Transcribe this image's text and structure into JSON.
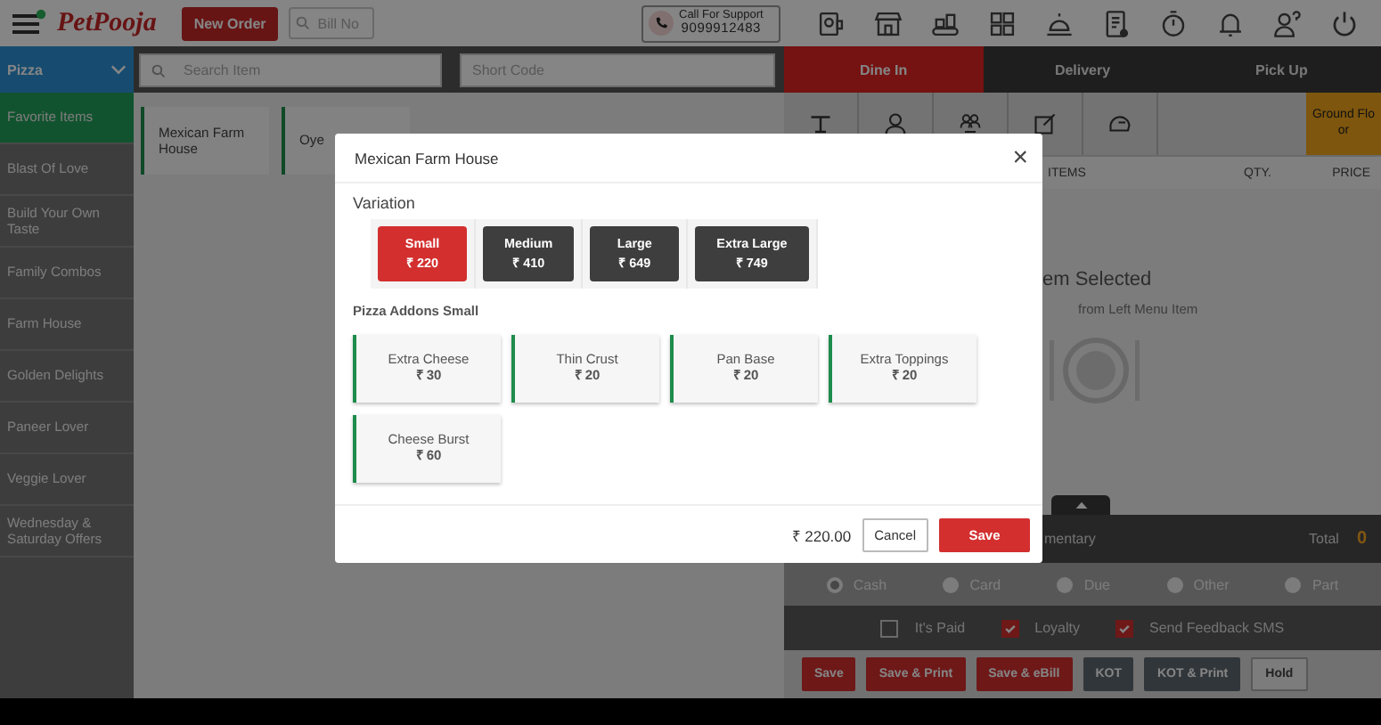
{
  "header": {
    "brand": "PetPooja",
    "new_order": "New Order",
    "bill_placeholder": "Bill No",
    "support_label": "Call For Support",
    "support_phone": "9099912483"
  },
  "category_select": "Pizza",
  "search": {
    "placeholder": "Search Item"
  },
  "short_code": {
    "placeholder": "Short Code"
  },
  "order_tabs": [
    {
      "label": "Dine In",
      "selected": true
    },
    {
      "label": "Delivery",
      "selected": false
    },
    {
      "label": "Pick Up",
      "selected": false
    }
  ],
  "floor_button": "Ground Floor",
  "categories": [
    {
      "label": "Favorite Items",
      "selected": true
    },
    {
      "label": "Blast Of Love",
      "selected": false
    },
    {
      "label": "Build Your Own Taste",
      "selected": false
    },
    {
      "label": "Family Combos",
      "selected": false
    },
    {
      "label": "Farm House",
      "selected": false
    },
    {
      "label": "Golden Delights",
      "selected": false
    },
    {
      "label": "Paneer Lover",
      "selected": false
    },
    {
      "label": "Veggie Lover",
      "selected": false
    },
    {
      "label": "Wednesday & Saturday Offers",
      "selected": false
    }
  ],
  "items": [
    "Mexican Farm House",
    "Oye"
  ],
  "order_columns": [
    "ITEMS",
    "QTY.",
    "PRICE"
  ],
  "empty_state": {
    "title": "em Selected",
    "hint": "from Left Menu Item"
  },
  "total_bar": {
    "cut_label": "mentary",
    "label": "Total",
    "value": "0"
  },
  "payment_modes": [
    {
      "label": "Cash",
      "selected": true
    },
    {
      "label": "Card",
      "selected": false
    },
    {
      "label": "Due",
      "selected": false
    },
    {
      "label": "Other",
      "selected": false
    },
    {
      "label": "Part",
      "selected": false
    }
  ],
  "options": [
    {
      "label": "It's Paid",
      "checked": false
    },
    {
      "label": "Loyalty",
      "checked": true
    },
    {
      "label": "Send Feedback SMS",
      "checked": true
    }
  ],
  "actions": [
    {
      "label": "Save",
      "kind": "primary"
    },
    {
      "label": "Save & Print",
      "kind": "primary"
    },
    {
      "label": "Save & eBill",
      "kind": "primary"
    },
    {
      "label": "KOT",
      "kind": "dark"
    },
    {
      "label": "KOT & Print",
      "kind": "dark"
    },
    {
      "label": "Hold",
      "kind": "outline"
    }
  ],
  "modal": {
    "title": "Mexican Farm House",
    "close": "×",
    "variation_label": "Variation",
    "variations": [
      {
        "name": "Small",
        "price": "₹ 220",
        "selected": true
      },
      {
        "name": "Medium",
        "price": "₹ 410",
        "selected": false
      },
      {
        "name": "Large",
        "price": "₹ 649",
        "selected": false
      },
      {
        "name": "Extra Large",
        "price": "₹ 749",
        "selected": false
      }
    ],
    "addons_label": "Pizza Addons Small",
    "addons": [
      {
        "name": "Extra Cheese",
        "price": "₹ 30"
      },
      {
        "name": "Thin Crust",
        "price": "₹ 20"
      },
      {
        "name": "Pan Base",
        "price": "₹ 20"
      },
      {
        "name": "Extra Toppings",
        "price": "₹ 20"
      },
      {
        "name": "Cheese Burst",
        "price": "₹ 60"
      }
    ],
    "total": "₹ 220.00",
    "cancel": "Cancel",
    "save": "Save"
  }
}
